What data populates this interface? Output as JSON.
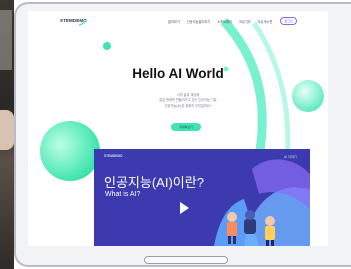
{
  "site": {
    "logo": "STEMDEMO",
    "menu": [
      "알아보기",
      "인공지능알아보기",
      "소프트웨어",
      "코딩기초",
      "자유게시판"
    ],
    "login_label": "로그인"
  },
  "hero": {
    "title": "Hello AI World",
    "body_lines": [
      "너의 삶과 세상에",
      "많은 변화를 만들어가고 있는 인공지능 기술",
      "인공지능(AI)은 정확히 무엇일까요?"
    ],
    "cta_label": "자세히보기"
  },
  "video": {
    "logo": "STEMDEMO",
    "right_label": "AI 이야기",
    "title": "인공지능(AI)이란?",
    "subtitle": "What is AI?"
  },
  "colors": {
    "accent_green": "#3fe3b4",
    "video_bg": "#3d3ab0",
    "brand_purple": "#7c6cf0"
  }
}
